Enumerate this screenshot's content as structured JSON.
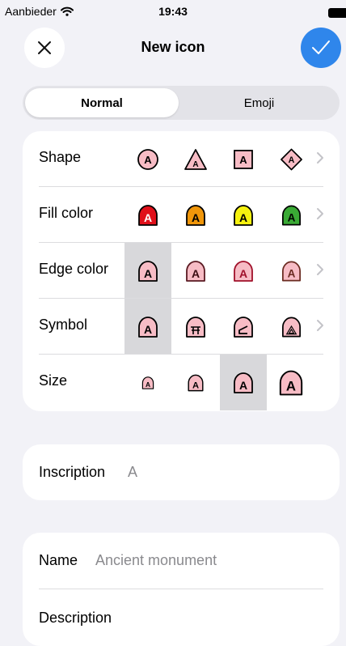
{
  "status_bar": {
    "carrier": "Aanbieder",
    "time": "19:43"
  },
  "nav": {
    "title": "New icon",
    "close_icon": "close-icon",
    "confirm_icon": "checkmark-icon"
  },
  "segments": [
    {
      "label": "Normal",
      "selected": true
    },
    {
      "label": "Emoji",
      "selected": false
    }
  ],
  "rows": [
    {
      "label": "Shape",
      "has_chevron": true,
      "selected_index": null,
      "letter": "A"
    },
    {
      "label": "Fill color",
      "has_chevron": true,
      "selected_index": null,
      "letter": "A",
      "fill_colors": [
        "#e0101a",
        "#f0960a",
        "#f6f20f",
        "#3aaa35"
      ]
    },
    {
      "label": "Edge color",
      "has_chevron": true,
      "selected_index": 0,
      "letter": "A"
    },
    {
      "label": "Symbol",
      "has_chevron": true,
      "selected_index": 0,
      "letter": "A"
    },
    {
      "label": "Size",
      "has_chevron": false,
      "selected_index": 2,
      "letter": "A"
    }
  ],
  "inscription": {
    "label": "Inscription",
    "value": "A"
  },
  "details": {
    "name_label": "Name",
    "name_value": "Ancient monument",
    "description_label": "Description"
  },
  "colors": {
    "accent": "#2f86eb",
    "icon_pink": "#f7bcc5",
    "selected_bg": "#d8d8db"
  }
}
